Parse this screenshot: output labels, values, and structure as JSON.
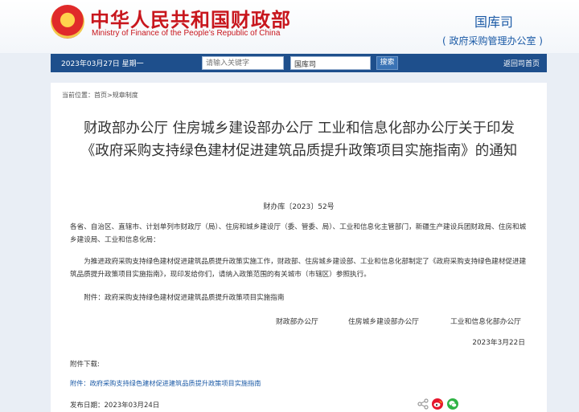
{
  "header": {
    "emblem_icon": "national-emblem",
    "ministry_cn": "中华人民共和国财政部",
    "ministry_en": "Ministry of Finance of the People’s Republic of China",
    "department": "国库司",
    "department_sub": "( 政府采购管理办公室 )"
  },
  "navbar": {
    "date": "2023年03月27日  星期一",
    "search_placeholder": "请输入关键字",
    "scope": "国库司",
    "search_label": "搜索",
    "back_label": "返回司首页"
  },
  "breadcrumb": {
    "prefix": "当前位置：",
    "home": "首页",
    "sep": ">",
    "section": "规章制度"
  },
  "article": {
    "title": "财政部办公厅 住房城乡建设部办公厅 工业和信息化部办公厅关于印发《政府采购支持绿色建材促进建筑品质提升政策项目实施指南》的通知",
    "doc_no": "财办库〔2023〕52号",
    "recipients": "各省、自治区、直辖市、计划单列市财政厅（局）、住房和城乡建设厅（委、管委、局）、工业和信息化主管部门，新疆生产建设兵团财政局、住房和城乡建设局、工业和信息化局：",
    "body": "为推进政府采购支持绿色建材促进建筑品质提升政策实施工作，财政部、住房城乡建设部、工业和信息化部制定了《政府采购支持绿色建材促进建筑品质提升政策项目实施指南》，现印发给你们，请纳入政策范围的有关城市（市辖区）参照执行。",
    "attachment": "附件：政府采购支持绿色建材促进建筑品质提升政策项目实施指南",
    "signers": [
      "财政部办公厅",
      "住房城乡建设部办公厅",
      "工业和信息化部办公厅"
    ],
    "sign_date": "2023年3月22日",
    "download_label": "附件下载:",
    "download_link": "附件：政府采购支持绿色建材促进建筑品质提升政策项目实施指南",
    "publish_date": "发布日期：2023年03月24日"
  },
  "share_icons": [
    "share-icon",
    "weibo-icon",
    "wechat-icon"
  ],
  "colors": {
    "brand_red": "#c8161d",
    "nav_blue": "#1e4f8c",
    "link_blue": "#1b5aa6"
  }
}
